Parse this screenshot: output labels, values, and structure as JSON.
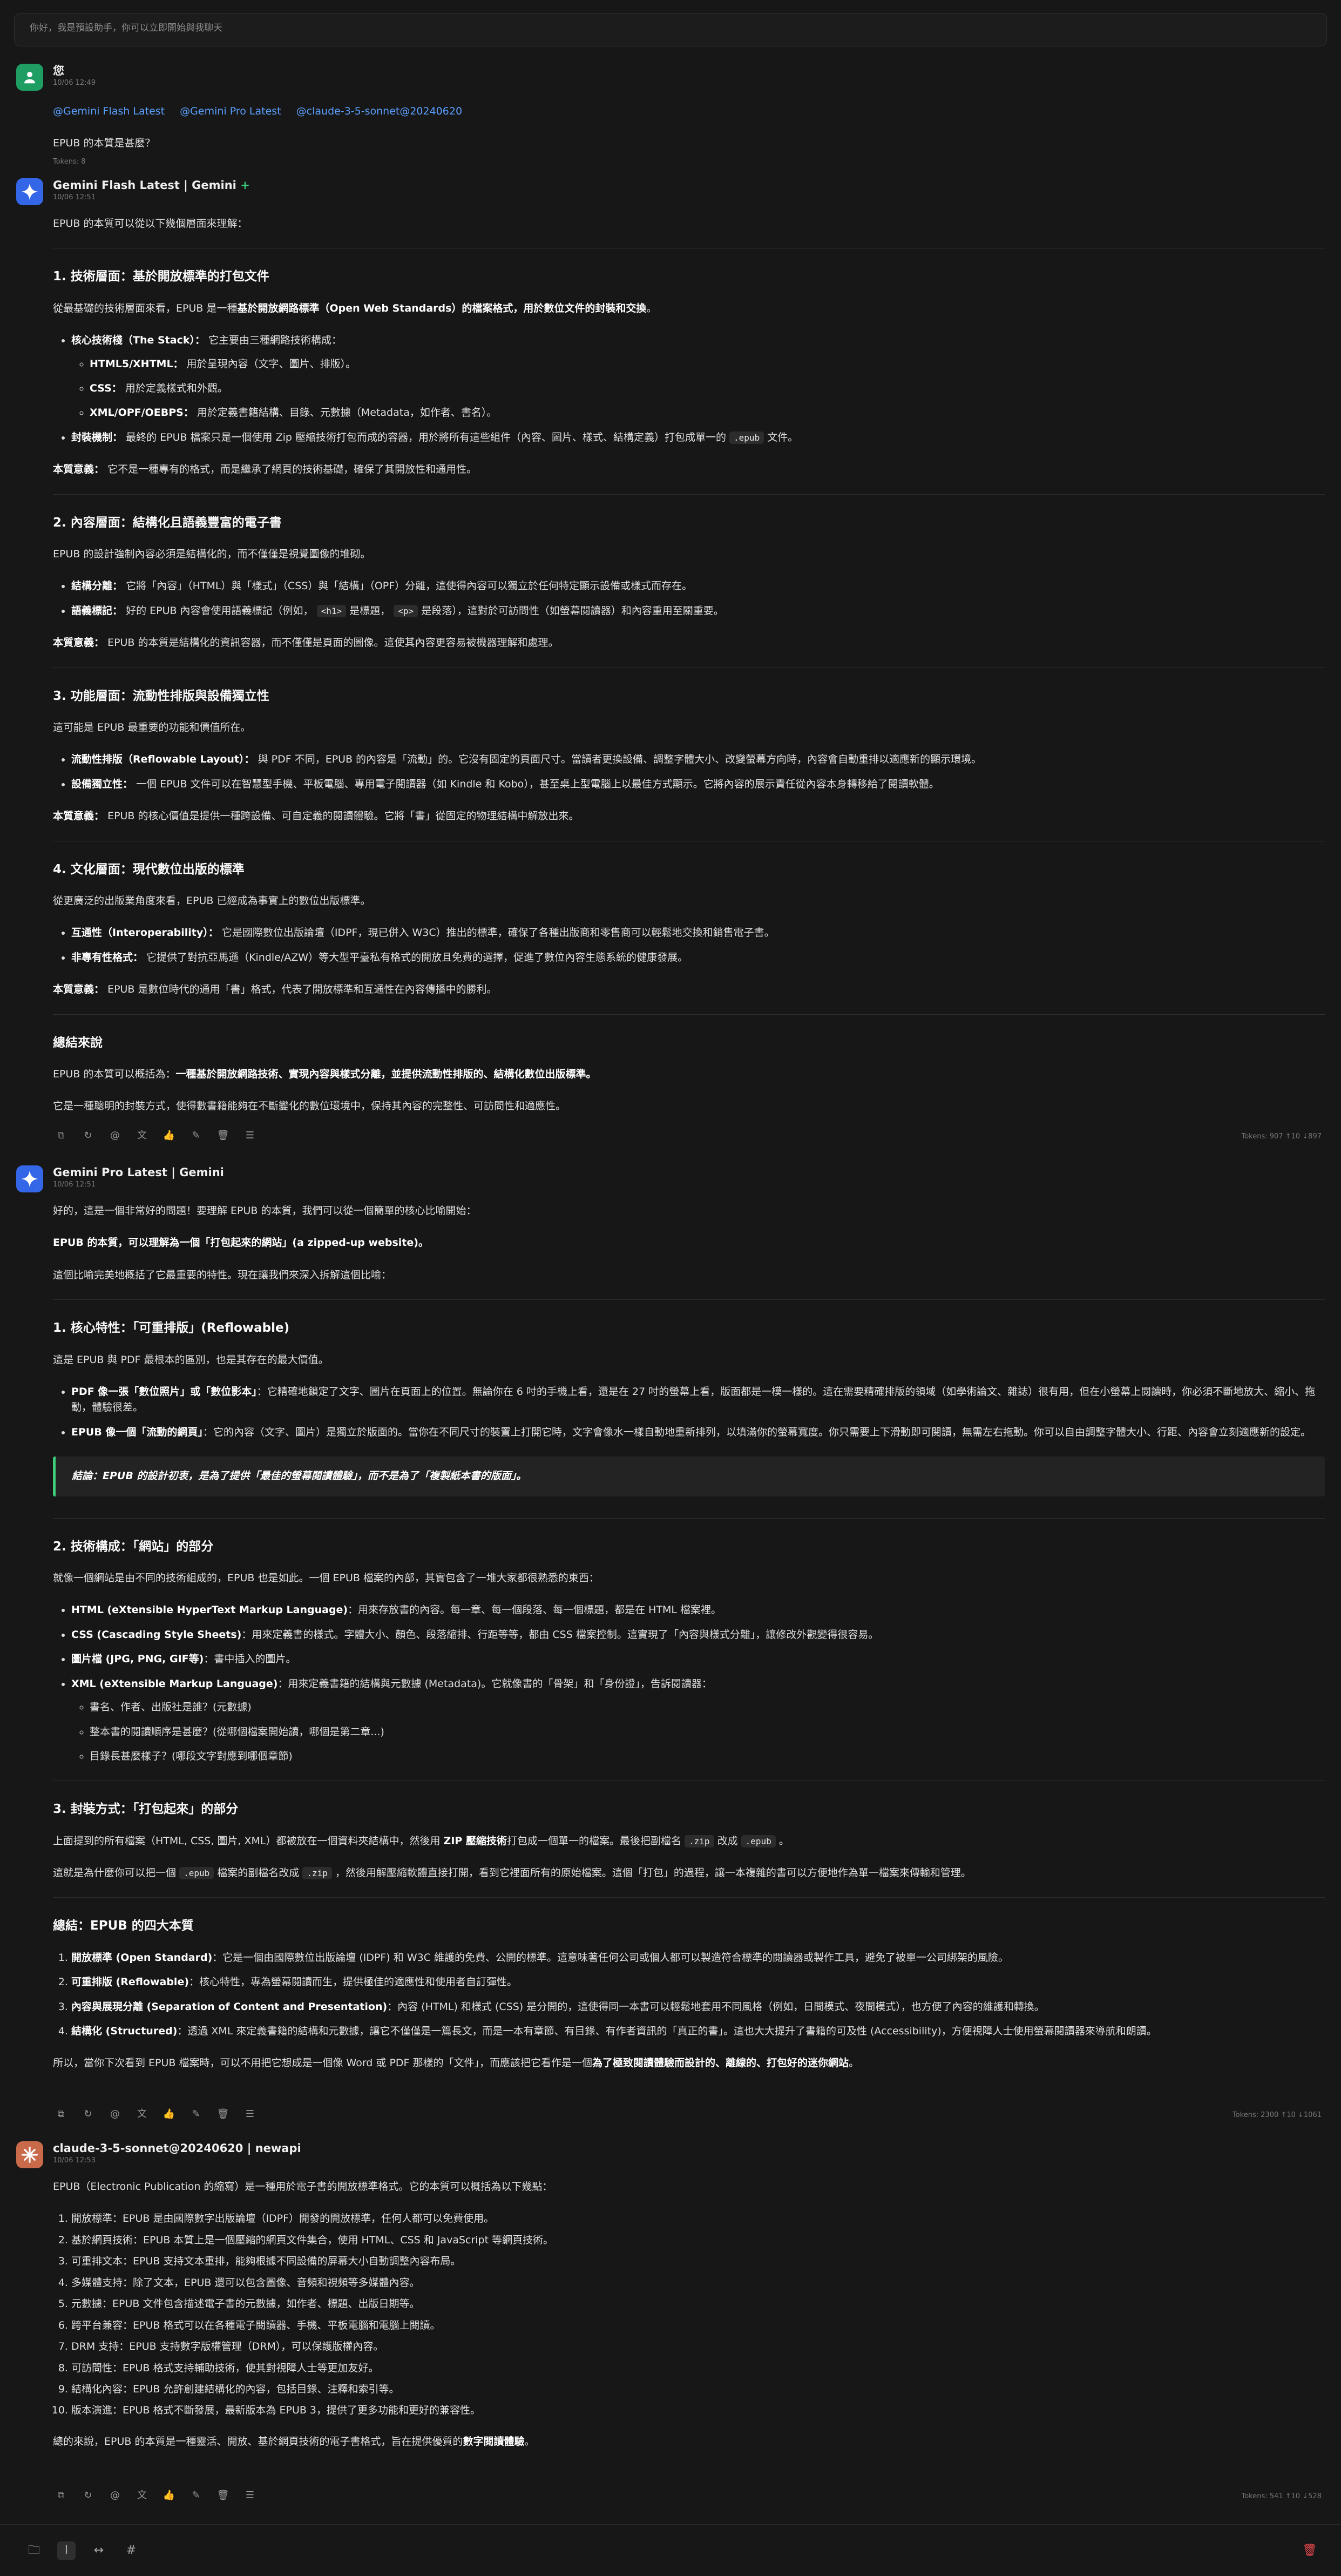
{
  "tip_bar": "你好，我是預設助手，你可以立即開始與我聊天",
  "user_msg": {
    "name": "您",
    "time": "10/06 12:49",
    "mentions": [
      "@Gemini Flash Latest",
      "@Gemini Pro Latest",
      "@claude-3-5-sonnet@20240620"
    ],
    "question": "EPUB 的本質是甚麼？",
    "tokens": "Tokens: 8"
  },
  "flash": {
    "name": "Gemini Flash Latest | Gemini",
    "plus": "+",
    "time": "10/06 12:51",
    "intro": "EPUB 的本質可以從以下幾個層面來理解：",
    "s1_title": "1. 技術層面：基於開放標準的打包文件",
    "s1_p1_a": "從最基礎的技術層面來看，EPUB 是一種",
    "s1_p1_b": "基於開放網路標準（Open Web Standards）的檔案格式，用於數位文件的封裝和交換",
    "s1_p1_c": "。",
    "s1_li1_b": "核心技術棧（The Stack）：",
    "s1_li1": "它主要由三種網路技術構成：",
    "s1_sub1_b": "HTML5/XHTML：",
    "s1_sub1": "用於呈現內容（文字、圖片、排版）。",
    "s1_sub2_b": "CSS：",
    "s1_sub2": "用於定義樣式和外觀。",
    "s1_sub3_b": "XML/OPF/OEBPS：",
    "s1_sub3": "用於定義書籍結構、目錄、元數據（Metadata，如作者、書名）。",
    "s1_li2_b": "封裝機制：",
    "s1_li2_a": "最終的 EPUB 檔案只是一個使用 Zip 壓縮技術打包而成的容器，用於將所有這些組件（內容、圖片、樣式、結構定義）打包成單一的",
    "s1_li2_code": ".epub",
    "s1_li2_c": "文件。",
    "s1_conc_b": "本質意義：",
    "s1_conc": "它不是一種專有的格式，而是繼承了網頁的技術基礎，確保了其開放性和通用性。",
    "s2_title": "2. 內容層面：結構化且語義豐富的電子書",
    "s2_p1": "EPUB 的設計強制內容必須是結構化的，而不僅僅是視覺圖像的堆砌。",
    "s2_li1_b": "結構分離：",
    "s2_li1": "它將「內容」（HTML）與「樣式」（CSS）與「結構」（OPF）分離，這使得內容可以獨立於任何特定顯示設備或樣式而存在。",
    "s2_li2_b": "語義標記：",
    "s2_li2_a": "好的 EPUB 內容會使用語義標記（例如，",
    "s2_li2_code1": "<h1>",
    "s2_li2_mid": "是標題，",
    "s2_li2_code2": "<p>",
    "s2_li2_c": "是段落），這對於可訪問性（如螢幕閱讀器）和內容重用至關重要。",
    "s2_conc_b": "本質意義：",
    "s2_conc": "EPUB 的本質是結構化的資訊容器，而不僅僅是頁面的圖像。這使其內容更容易被機器理解和處理。",
    "s3_title": "3. 功能層面：流動性排版與設備獨立性",
    "s3_p1": "這可能是 EPUB 最重要的功能和價值所在。",
    "s3_li1_b": "流動性排版（Reflowable Layout）：",
    "s3_li1": "與 PDF 不同，EPUB 的內容是「流動」的。它沒有固定的頁面尺寸。當讀者更換設備、調整字體大小、改變螢幕方向時，內容會自動重排以適應新的顯示環境。",
    "s3_li2_b": "設備獨立性：",
    "s3_li2": "一個 EPUB 文件可以在智慧型手機、平板電腦、專用電子閱讀器（如 Kindle 和 Kobo），甚至桌上型電腦上以最佳方式顯示。它將內容的展示責任從內容本身轉移給了閱讀軟體。",
    "s3_conc_b": "本質意義：",
    "s3_conc": "EPUB 的核心價值是提供一種跨設備、可自定義的閱讀體驗。它將「書」從固定的物理結構中解放出來。",
    "s4_title": "4. 文化層面：現代數位出版的標準",
    "s4_p1": "從更廣泛的出版業角度來看，EPUB 已經成為事實上的數位出版標準。",
    "s4_li1_b": "互通性（Interoperability）：",
    "s4_li1": "它是國際數位出版論壇（IDPF，現已併入 W3C）推出的標準，確保了各種出版商和零售商可以輕鬆地交換和銷售電子書。",
    "s4_li2_b": "非專有性格式：",
    "s4_li2": "它提供了對抗亞馬遜（Kindle/AZW）等大型平臺私有格式的開放且免費的選擇，促進了數位內容生態系統的健康發展。",
    "s4_conc_b": "本質意義：",
    "s4_conc": "EPUB 是數位時代的通用「書」格式，代表了開放標準和互通性在內容傳播中的勝利。",
    "sum_title": "總結來說",
    "sum_p1_a": "EPUB 的本質可以概括為：",
    "sum_p1_b": "一種基於開放網路技術、實現內容與樣式分離，並提供流動性排版的、結構化數位出版標準。",
    "sum_p2": "它是一種聰明的封裝方式，使得數書籍能夠在不斷變化的數位環境中，保持其內容的完整性、可訪問性和適應性。",
    "tokens": "Tokens: 907 ↑10 ↓897"
  },
  "pro": {
    "name": "Gemini Pro Latest | Gemini",
    "time": "10/06 12:51",
    "p1": "好的，這是一個非常好的問題！要理解 EPUB 的本質，我們可以從一個簡單的核心比喻開始：",
    "p2": "EPUB 的本質，可以理解為一個「打包起來的網站」(a zipped-up website)。",
    "p3": "這個比喻完美地概括了它最重要的特性。現在讓我們來深入拆解這個比喻：",
    "s1_title": "1. 核心特性：「可重排版」(Reflowable)",
    "s1_p1": "這是 EPUB 與 PDF 最根本的區別，也是其存在的最大價值。",
    "s1_li1_b": "PDF 像一張「數位照片」或「數位影本」",
    "s1_li1": "：它精確地鎖定了文字、圖片在頁面上的位置。無論你在 6 吋的手機上看，還是在 27 吋的螢幕上看，版面都是一模一樣的。這在需要精確排版的領域（如學術論文、雜誌）很有用，但在小螢幕上閱讀時，你必須不斷地放大、縮小、拖動，體驗很差。",
    "s1_li2_b": "EPUB 像一個「流動的網頁」",
    "s1_li2": "：它的內容（文字、圖片）是獨立於版面的。當你在不同尺寸的裝置上打開它時，文字會像水一樣自動地重新排列，以填滿你的螢幕寬度。你只需要上下滑動即可閱讀，無需左右拖動。你可以自由調整字體大小、行距、內容會立刻適應新的設定。",
    "quote": "結論：EPUB 的設計初衷，是為了提供「最佳的螢幕閱讀體驗」，而不是為了「複製紙本書的版面」。",
    "s2_title": "2. 技術構成：「網站」的部分",
    "s2_p1": "就像一個網站是由不同的技術組成的，EPUB 也是如此。一個 EPUB 檔案的內部，其實包含了一堆大家都很熟悉的東西：",
    "s2_li1_b": "HTML (eXtensible HyperText Markup Language)",
    "s2_li1": "：用來存放書的內容。每一章、每一個段落、每一個標題，都是在 HTML 檔案裡。",
    "s2_li2_b": "CSS (Cascading Style Sheets)",
    "s2_li2": "：用來定義書的樣式。字體大小、顏色、段落縮排、行距等等，都由 CSS 檔案控制。這實現了「內容與樣式分離」，讓修改外觀變得很容易。",
    "s2_li3_b": "圖片檔 (JPG, PNG, GIF等)",
    "s2_li3": "：書中插入的圖片。",
    "s2_li4_b": "XML (eXtensible Markup Language)",
    "s2_li4": "：用來定義書籍的結構與元數據 (Metadata)。它就像書的「骨架」和「身份證」，告訴閱讀器：",
    "s2_sub1": "書名、作者、出版社是誰？(元數據)",
    "s2_sub2": "整本書的閱讀順序是甚麼？(從哪個檔案開始讀，哪個是第二章...)",
    "s2_sub3": "目錄長甚麼樣子？(哪段文字對應到哪個章節)",
    "s3_title": "3. 封裝方式：「打包起來」的部分",
    "s3_p1_a": "上面提到的所有檔案（HTML, CSS, 圖片, XML）都被放在一個資料夾結構中，然後用",
    "s3_p1_b": "ZIP 壓縮技術",
    "s3_p1_c": "打包成一個單一的檔案。最後把副檔名",
    "s3_p1_code1": ".zip",
    "s3_p1_d": "改成",
    "s3_p1_code2": ".epub",
    "s3_p1_e": "。",
    "s3_p2_a": "這就是為什麼你可以把一個",
    "s3_p2_code1": ".epub",
    "s3_p2_b": "檔案的副檔名改成",
    "s3_p2_code2": ".zip",
    "s3_p2_c": "，然後用解壓縮軟體直接打開，看到它裡面所有的原始檔案。這個「打包」的過程，讓一本複雜的書可以方便地作為單一檔案來傳輸和管理。",
    "sum_title": "總結：EPUB 的四大本質",
    "sum_li1_b": "開放標準 (Open Standard)",
    "sum_li1": "：它是一個由國際數位出版論壇 (IDPF) 和 W3C 維護的免費、公開的標準。這意味著任何公司或個人都可以製造符合標準的閱讀器或製作工具，避免了被單一公司綁架的風險。",
    "sum_li2_b": "可重排版 (Reflowable)",
    "sum_li2": "：核心特性，專為螢幕閱讀而生，提供極佳的適應性和使用者自訂彈性。",
    "sum_li3_b": "內容與展現分離 (Separation of Content and Presentation)",
    "sum_li3": "：內容 (HTML) 和樣式 (CSS) 是分開的，這使得同一本書可以輕鬆地套用不同風格（例如，日間模式、夜間模式），也方便了內容的維護和轉換。",
    "sum_li4_b": "結構化 (Structured)",
    "sum_li4": "：透過 XML 來定義書籍的結構和元數據，讓它不僅僅是一篇長文，而是一本有章節、有目錄、有作者資訊的「真正的書」。這也大大提升了書籍的可及性 (Accessibility)，方便視障人士使用螢幕閱讀器來導航和朗讀。",
    "final_a": "所以，當你下次看到 EPUB 檔案時，可以不用把它想成是一個像 Word 或 PDF 那樣的「文件」，而應該把它看作是一個",
    "final_b": "為了極致閱讀體驗而設計的、離線的、打包好的迷你網站",
    "final_c": "。",
    "tokens": "Tokens: 2300 ↑10 ↓1061"
  },
  "claude": {
    "name": "claude-3-5-sonnet@20240620 | newapi",
    "time": "10/06 12:53",
    "intro": "EPUB（Electronic Publication 的縮寫）是一種用於電子書的開放標準格式。它的本質可以概括為以下幾點：",
    "items": [
      "開放標準：EPUB 是由國際數字出版論壇（IDPF）開發的開放標準，任何人都可以免費使用。",
      "基於網頁技術：EPUB 本質上是一個壓縮的網頁文件集合，使用 HTML、CSS 和 JavaScript 等網頁技術。",
      "可重排文本：EPUB 支持文本重排，能夠根據不同設備的屏幕大小自動調整內容布局。",
      "多媒體支持：除了文本，EPUB 還可以包含圖像、音頻和視頻等多媒體內容。",
      "元數據：EPUB 文件包含描述電子書的元數據，如作者、標題、出版日期等。",
      "跨平台兼容：EPUB 格式可以在各種電子閱讀器、手機、平板電腦和電腦上閱讀。",
      "DRM 支持：EPUB 支持數字版權管理（DRM），可以保護版權內容。",
      "可訪問性：EPUB 格式支持輔助技術，使其對視障人士等更加友好。",
      "結構化內容：EPUB 允許創建結構化的內容，包括目錄、注釋和索引等。",
      "版本演進：EPUB 格式不斷發展，最新版本為 EPUB 3，提供了更多功能和更好的兼容性。"
    ],
    "outro_a": "總的來說，EPUB 的本質是一種靈活、開放、基於網頁技術的電子書格式，旨在提供優質的",
    "outro_b": "數字閱讀體驗",
    "outro_c": "。",
    "tokens": "Tokens: 541 ↑10 ↓528"
  },
  "colors": {
    "bg": "#171717",
    "accent_green": "#3fcf7a",
    "mention": "#5aa0ff",
    "danger": "#e5484d"
  }
}
